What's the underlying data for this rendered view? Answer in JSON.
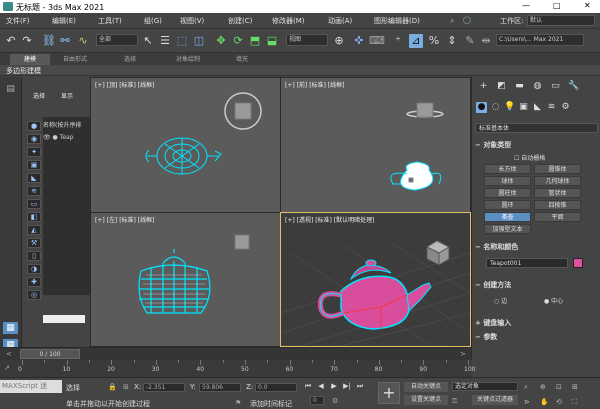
{
  "window": {
    "title": "无标题 - 3ds Max 2021",
    "minimize": "—",
    "maximize": "□",
    "close": "✕"
  },
  "menu": {
    "items": [
      "文件(F)",
      "编辑(E)",
      "工具(T)",
      "组(G)",
      "视图(V)",
      "创建(C)",
      "修改器(M)",
      "动画(A)",
      "图形编辑器(D)"
    ],
    "workspace_label": "工作区:",
    "workspace_value": "默认"
  },
  "toolbar": {
    "filter_value": "全部",
    "refcoord_value": "视图",
    "path_value": "C:\\Users\\... Max 2021"
  },
  "ribbon": {
    "tabs": [
      "建模",
      "自由形式",
      "选择",
      "对象绘制",
      "填充"
    ],
    "subtab": "多边形建模"
  },
  "scene_explorer": {
    "tabs": [
      "选择",
      "显示"
    ],
    "header": "名称(按升序排",
    "rows": [
      "Teap"
    ]
  },
  "viewports": {
    "top_left": "[+] [顶] [标准] [线框]",
    "top_right": "[+] [前] [标准] [线框]",
    "bottom_left": "[+] [左] [标准] [线框]",
    "bottom_right": "[+] [透视] [标准] [默认明暗处理]"
  },
  "command_panel": {
    "category": "标准基本体",
    "object_type_title": "对象类型",
    "autogrid": "自动栅格",
    "buttons": [
      "长方体",
      "圆锥体",
      "球体",
      "几何球体",
      "圆柱体",
      "管状体",
      "圆环",
      "四棱锥",
      "茶壶",
      "平面",
      "加强型文本"
    ],
    "selected_button": "茶壶",
    "name_color_title": "名称和颜色",
    "object_name": "Teapot001",
    "object_color": "#e050a0",
    "creation_method_title": "创建方法",
    "radio_edge": "边",
    "radio_center": "中心",
    "keyboard_title": "键盘输入",
    "params_title": "参数"
  },
  "timeline": {
    "frame_display": "0 / 100",
    "ticks": [
      "0",
      "10",
      "20",
      "30",
      "40",
      "50",
      "60",
      "70",
      "80",
      "90",
      "100"
    ]
  },
  "status": {
    "selected": "选择",
    "maxscript": "MAXScript 迷",
    "prompt": "单击并拖动以开始创建过程",
    "x_label": "X:",
    "x_value": "-2.351",
    "y_label": "Y:",
    "y_value": "59.806",
    "z_label": "Z:",
    "z_value": "0.0",
    "add_time_tag": "添加时间标记",
    "auto_key": "自动关键点",
    "set_key": "设置关键点",
    "selected_object": "选定对象",
    "key_filters": "关键点过滤器"
  },
  "colors": {
    "accent": "#5b8fc4",
    "wireframe": "#00e5ff",
    "teapot": "#d94e9c",
    "active_border": "#e0c060"
  }
}
